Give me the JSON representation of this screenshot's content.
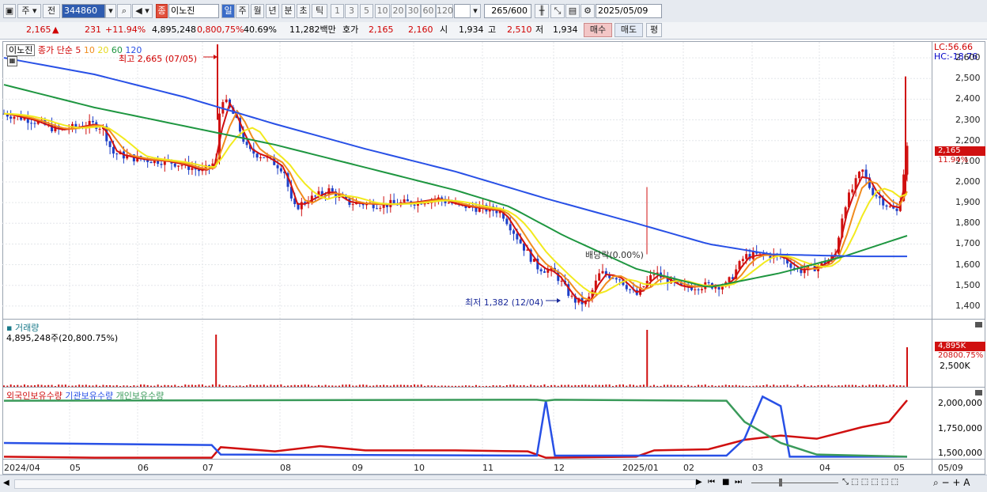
{
  "toolbar": {
    "market_label": "주",
    "prev_label": "전",
    "code_value": "344860",
    "name_value": "이노진",
    "name_badge": "종",
    "periods": [
      "일",
      "주",
      "월",
      "년",
      "분",
      "초",
      "틱"
    ],
    "active_period": "일",
    "intervals": [
      "1",
      "3",
      "5",
      "10",
      "20",
      "30",
      "60",
      "120"
    ],
    "count_value": "265",
    "count_total": "/600",
    "date_value": "2025/05/09"
  },
  "infobar": {
    "price": "2,165",
    "change": "231",
    "change_pct": "+11.94%",
    "volume": "4,895,248",
    "volume_ratio": "0,800,75%",
    "turnover": "40.69%",
    "amount": "11,282백만",
    "quote_label": "호가",
    "ask": "2,165",
    "bid": "2,160",
    "open_label": "시",
    "open": "1,934",
    "high_label": "고",
    "high": "2,510",
    "low_label": "저",
    "low": "1,934",
    "buy_label": "매수",
    "sell_label": "매도",
    "eval_label": "평"
  },
  "price_panel": {
    "stock_name": "이노진",
    "ma_title": "종가 단순",
    "ma_periods": [
      "5",
      "10",
      "20",
      "60",
      "120"
    ],
    "high_annotation": "최고 2,665 (07/05)",
    "low_annotation": "최저 1,382 (12/04)",
    "dividend_annotation": "배당락(0.00%)",
    "lc_label": "LC:56.66",
    "hc_label": "HC:-18.76",
    "last_price_tag": "2,165",
    "last_pct_tag": "11.94%",
    "y_ticks": [
      "2,600",
      "2,500",
      "2,400",
      "2,300",
      "2,200",
      "2,100",
      "2,000",
      "1,900",
      "1,800",
      "1,700",
      "1,600",
      "1,500",
      "1,400"
    ]
  },
  "volume_panel": {
    "title": "거래량",
    "value_text": "4,895,248주(20,800.75%)",
    "tag_volume": "4,895K",
    "tag_ratio": "20800.75%",
    "y_tick": "2,500K"
  },
  "holdings_panel": {
    "series": [
      "외국인보유수량",
      "기관보유수량",
      "개인보유수량"
    ],
    "y_ticks": [
      "2,000,000",
      "1,750,000",
      "1,500,000"
    ]
  },
  "x_axis": [
    "2024/04",
    "05",
    "06",
    "07",
    "08",
    "09",
    "10",
    "11",
    "12",
    "2025/01",
    "02",
    "03",
    "04",
    "05",
    "05/09"
  ],
  "colors": {
    "ma5": "#d01010",
    "ma10": "#f08c1e",
    "ma20": "#f2ea1e",
    "ma60": "#1e9640",
    "ma120": "#2850e6",
    "foreign": "#d01010",
    "institution": "#2850e6",
    "individual": "#3a9a5a",
    "up": "#d01010",
    "down": "#1e40c8"
  },
  "chart_data": {
    "type": "line",
    "price_range": [
      1350,
      2650
    ],
    "ma120": [
      [
        0,
        2600
      ],
      [
        0.1,
        2520
      ],
      [
        0.2,
        2410
      ],
      [
        0.3,
        2280
      ],
      [
        0.4,
        2160
      ],
      [
        0.5,
        2050
      ],
      [
        0.6,
        1920
      ],
      [
        0.7,
        1800
      ],
      [
        0.78,
        1700
      ],
      [
        0.85,
        1650
      ],
      [
        0.95,
        1640
      ],
      [
        1,
        1640
      ]
    ],
    "ma60": [
      [
        0,
        2470
      ],
      [
        0.1,
        2360
      ],
      [
        0.2,
        2270
      ],
      [
        0.3,
        2180
      ],
      [
        0.4,
        2070
      ],
      [
        0.5,
        1960
      ],
      [
        0.56,
        1880
      ],
      [
        0.62,
        1740
      ],
      [
        0.7,
        1580
      ],
      [
        0.78,
        1490
      ],
      [
        0.86,
        1560
      ],
      [
        0.93,
        1640
      ],
      [
        1,
        1740
      ]
    ],
    "holdings_range": [
      1450000,
      2050000
    ]
  }
}
